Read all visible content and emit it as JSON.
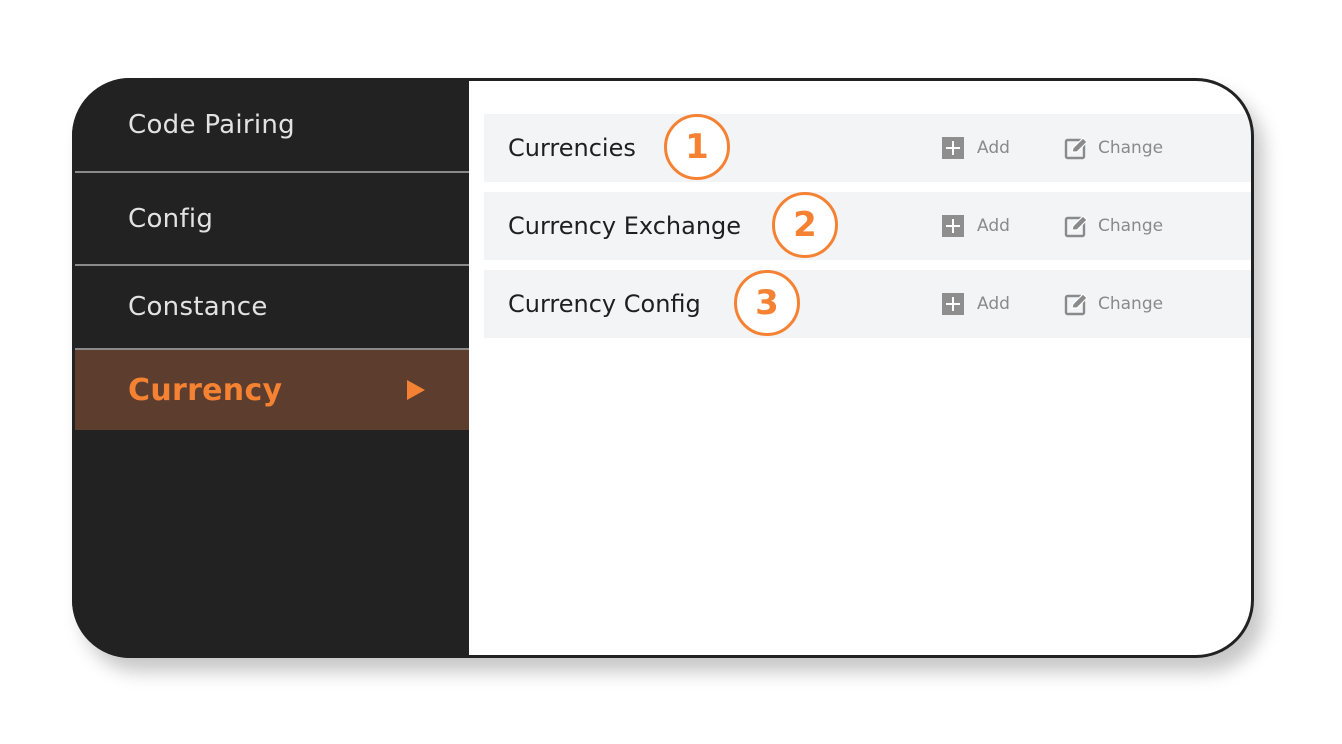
{
  "sidebar": {
    "items": [
      {
        "label": "Code Pairing"
      },
      {
        "label": "Config"
      },
      {
        "label": "Constance"
      },
      {
        "label": "Currency",
        "active": true
      }
    ]
  },
  "main": {
    "rows": [
      {
        "title": "Currencies",
        "badge": "1",
        "add_label": "Add",
        "change_label": "Change"
      },
      {
        "title": "Currency Exchange",
        "badge": "2",
        "add_label": "Add",
        "change_label": "Change"
      },
      {
        "title": "Currency Config",
        "badge": "3",
        "add_label": "Add",
        "change_label": "Change"
      }
    ]
  },
  "colors": {
    "accent": "#f58233",
    "sidebar_bg": "#222222",
    "active_bg": "#5c3d2e",
    "row_bg": "#f3f4f6"
  },
  "icons": {
    "add": "plus-square-icon",
    "change": "edit-pencil-icon",
    "active_indicator": "triangle-right-icon"
  }
}
